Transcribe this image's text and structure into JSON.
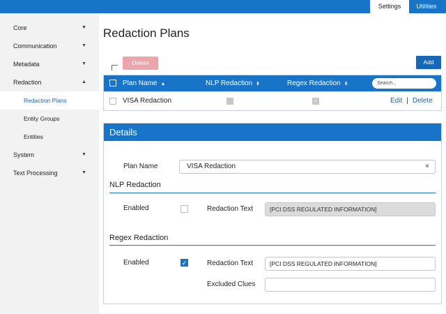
{
  "top_tabs": [
    {
      "label": "Settings",
      "active": true
    },
    {
      "label": "Utilities",
      "active": false
    }
  ],
  "sidebar": {
    "items": [
      {
        "label": "Core",
        "expanded": false
      },
      {
        "label": "Communication",
        "expanded": false
      },
      {
        "label": "Metadata",
        "expanded": false
      },
      {
        "label": "Redaction",
        "expanded": true
      },
      {
        "label": "System",
        "expanded": false
      },
      {
        "label": "Text Processing",
        "expanded": false
      }
    ],
    "redaction_children": [
      {
        "label": "Redaction Plans",
        "active": true
      },
      {
        "label": "Entity Groups",
        "active": false
      },
      {
        "label": "Entities",
        "active": false
      }
    ]
  },
  "page": {
    "title": "Redaction Plans",
    "delete_label": "Delete",
    "add_label": "Add"
  },
  "table": {
    "columns": [
      "Plan Name",
      "NLP Redaction",
      "Regex Redaction"
    ],
    "search_placeholder": "Search...",
    "rows": [
      {
        "plan_name": "VISA Redaction",
        "nlp": false,
        "regex": true,
        "edit_label": "Edit",
        "sep": "|",
        "delete_label": "Delete"
      }
    ]
  },
  "details": {
    "title": "Details",
    "plan_name_label": "Plan Name",
    "plan_name_value": "VISA Redaction",
    "clear_glyph": "×",
    "nlp": {
      "title": "NLP Redaction",
      "enabled_label": "Enabled",
      "enabled": false,
      "text_label": "Redaction Text",
      "text_value": "[PCI DSS REGULATED INFORMATION]"
    },
    "regex": {
      "title": "Regex Redaction",
      "enabled_label": "Enabled",
      "enabled": true,
      "text_label": "Redaction Text",
      "text_value": "[PCI DSS REGULATED INFORMATION]",
      "clues_label": "Excluded Clues",
      "clues_value": ""
    }
  },
  "glyphs": {
    "chevron_down": "▼",
    "chevron_up": "▲",
    "sort_asc": "▲",
    "sort_both": "⬍",
    "check": "✓"
  },
  "colors": {
    "brand": "#1874c7",
    "link": "#1565c0",
    "danger_disabled": "#eba5ab"
  }
}
